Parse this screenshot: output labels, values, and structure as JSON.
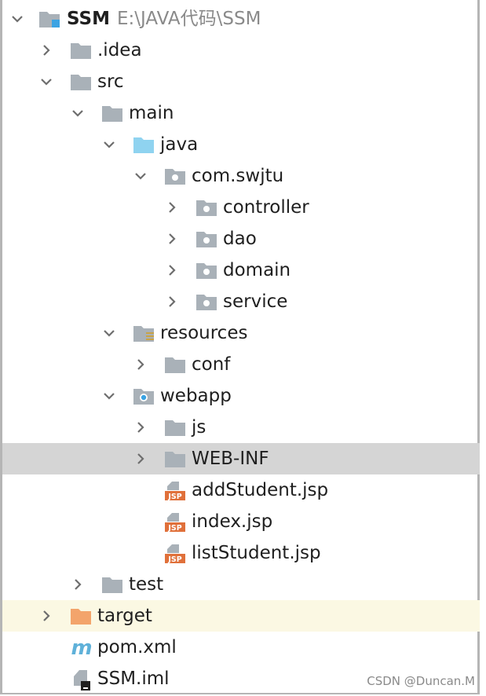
{
  "project": {
    "name": "SSM",
    "path": "E:\\JAVA代码\\SSM"
  },
  "tree": {
    "idea": ".idea",
    "src": "src",
    "main": "main",
    "java": "java",
    "package": "com.swjtu",
    "controller": "controller",
    "dao": "dao",
    "domain": "domain",
    "service": "service",
    "resources": "resources",
    "conf": "conf",
    "webapp": "webapp",
    "js": "js",
    "webinf": "WEB-INF",
    "file_add": "addStudent.jsp",
    "file_index": "index.jsp",
    "file_list": "listStudent.jsp",
    "test": "test",
    "target": "target",
    "pom": "pom.xml",
    "iml": "SSM.iml"
  },
  "badges": {
    "jsp": "JSP",
    "maven": "m"
  },
  "colors": {
    "folder": "#a9b1b8",
    "source_root": "#8fd3f0",
    "excluded_folder": "#f3a46b",
    "selected_row": "#d5d5d5",
    "excluded_row": "#fbf8e3",
    "jsp_badge": "#e0703a",
    "maven": "#5fb1d9"
  },
  "watermark": "CSDN @Duncan.M"
}
